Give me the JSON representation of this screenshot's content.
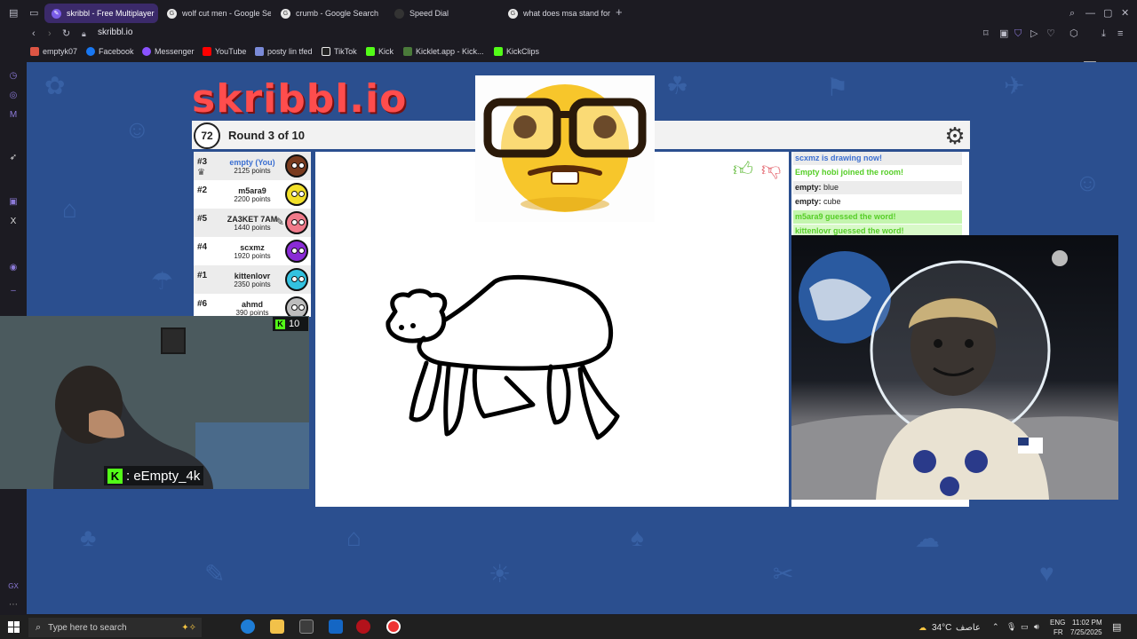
{
  "browser": {
    "tabs": [
      {
        "label": "skribbl - Free Multiplayer",
        "active": true
      },
      {
        "label": "wolf cut men - Google Se",
        "active": false
      },
      {
        "label": "crumb - Google Search",
        "active": false
      },
      {
        "label": "Speed Dial",
        "active": false
      },
      {
        "label": "what does msa stand for",
        "active": false
      }
    ],
    "new_tab": "+",
    "url": "skribbl.io",
    "bookmarks": [
      "emptyk07",
      "Facebook",
      "Messenger",
      "YouTube",
      "posty lin tfed",
      "TikTok",
      "Kick",
      "Kicklet.app - Kick...",
      "KickClips"
    ]
  },
  "game": {
    "logo": "skribbl.io",
    "timer": "72",
    "round": "Round 3 of 10",
    "players": [
      {
        "rank": "#3",
        "name": "empty (You)",
        "points": "2125 points",
        "color": "#7a3b1e",
        "you": true
      },
      {
        "rank": "#2",
        "name": "m5ara9",
        "points": "2200 points",
        "color": "#f2e02a",
        "you": false
      },
      {
        "rank": "#5",
        "name": "ZA3KET 7AM",
        "points": "1440 points",
        "color": "#f07a8a",
        "you": false
      },
      {
        "rank": "#4",
        "name": "scxmz",
        "points": "1920 points",
        "color": "#8a2bd6",
        "you": false
      },
      {
        "rank": "#1",
        "name": "kittenlovr",
        "points": "2350 points",
        "color": "#33c2e0",
        "you": false
      },
      {
        "rank": "#6",
        "name": "ahmd",
        "points": "390 points",
        "color": "#bdbdbd",
        "you": false
      }
    ],
    "chat": [
      {
        "text": "scxmz is drawing now!",
        "color": "#3b6fd1",
        "bg": "#ececec",
        "user": ""
      },
      {
        "text": "Empty hobi joined the room!",
        "color": "#56ce27",
        "bg": "#ffffff",
        "user": ""
      },
      {
        "text": "blue",
        "color": "#222222",
        "bg": "#ececec",
        "user": "empty:"
      },
      {
        "text": "cube",
        "color": "#222222",
        "bg": "#ffffff",
        "user": "empty:"
      },
      {
        "text": "m5ara9 guessed the word!",
        "color": "#56ce27",
        "bg": "#c4f5ae",
        "user": ""
      },
      {
        "text": "kittenlovr guessed the word!",
        "color": "#56ce27",
        "bg": "#d8f9c8",
        "user": ""
      }
    ]
  },
  "stream": {
    "viewers": "10",
    "label": ": eEmpty_4k"
  },
  "taskbar": {
    "search_placeholder": "Type here to search",
    "weather": "34°C",
    "weather_text": "عاصف",
    "lang1": "ENG",
    "lang2": "FR",
    "time": "11:02 PM",
    "date": "7/25/2025"
  },
  "colors": {
    "accent": "#6b4de6",
    "page_bg": "#2b4f8f",
    "kick_green": "#53fc18"
  }
}
